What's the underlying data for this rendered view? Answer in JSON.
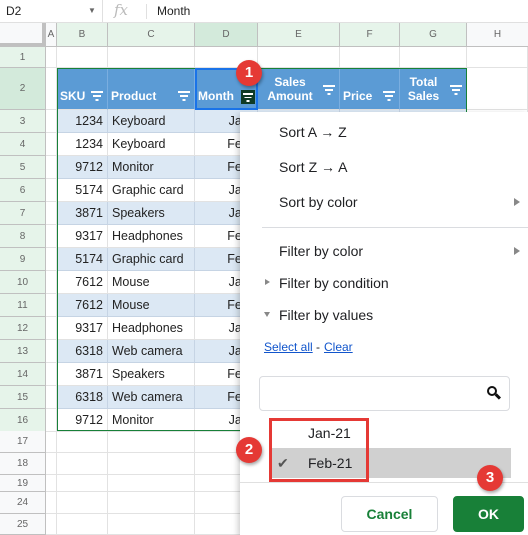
{
  "formula_bar": {
    "cell_ref": "D2",
    "fx_label": "fx",
    "value": "Month"
  },
  "columns": [
    "A",
    "B",
    "C",
    "D",
    "E",
    "F",
    "G",
    "H"
  ],
  "rows": [
    "1",
    "2",
    "3",
    "4",
    "5",
    "6",
    "7",
    "8",
    "9",
    "10",
    "11",
    "12",
    "13",
    "14",
    "15",
    "16",
    "17",
    "18",
    "19",
    "24",
    "25"
  ],
  "table": {
    "headers": [
      {
        "label": "SKU"
      },
      {
        "label": "Product"
      },
      {
        "label": "Month",
        "filter_active": true
      },
      {
        "label": "Sales Amount"
      },
      {
        "label": "Price"
      },
      {
        "label": "Total Sales"
      }
    ],
    "rows": [
      {
        "sku": "1234",
        "product": "Keyboard",
        "month": "Jan-"
      },
      {
        "sku": "1234",
        "product": "Keyboard",
        "month": "Feb-"
      },
      {
        "sku": "9712",
        "product": "Monitor",
        "month": "Feb-"
      },
      {
        "sku": "5174",
        "product": "Graphic card",
        "month": "Jan-"
      },
      {
        "sku": "3871",
        "product": "Speakers",
        "month": "Jan-"
      },
      {
        "sku": "9317",
        "product": "Headphones",
        "month": "Feb-"
      },
      {
        "sku": "5174",
        "product": "Graphic card",
        "month": "Feb-"
      },
      {
        "sku": "7612",
        "product": "Mouse",
        "month": "Jan-"
      },
      {
        "sku": "7612",
        "product": "Mouse",
        "month": "Feb-"
      },
      {
        "sku": "9317",
        "product": "Headphones",
        "month": "Jan-"
      },
      {
        "sku": "6318",
        "product": "Web camera",
        "month": "Jan-"
      },
      {
        "sku": "3871",
        "product": "Speakers",
        "month": "Feb-"
      },
      {
        "sku": "6318",
        "product": "Web camera",
        "month": "Feb-"
      },
      {
        "sku": "9712",
        "product": "Monitor",
        "month": "Jan-"
      }
    ]
  },
  "filter_menu": {
    "sort_az": "Sort A → Z",
    "sort_za": "Sort Z → A",
    "sort_by_color": "Sort by color",
    "filter_by_color": "Filter by color",
    "filter_by_condition": "Filter by condition",
    "filter_by_values": "Filter by values",
    "select_all": "Select all",
    "separator": "-",
    "clear": "Clear",
    "search_value": "",
    "options": [
      {
        "label": "Jan-21",
        "checked": false,
        "check_mark": ""
      },
      {
        "label": "Feb-21",
        "checked": true,
        "check_mark": "✔"
      }
    ],
    "cancel_label": "Cancel",
    "ok_label": "OK"
  },
  "annotations": {
    "step1": "1",
    "step2": "2",
    "step3": "3"
  },
  "colors": {
    "header_blue": "#5b9bd5",
    "alt_row": "#dce8f4",
    "green": "#188038",
    "badge_red": "#e53935"
  }
}
